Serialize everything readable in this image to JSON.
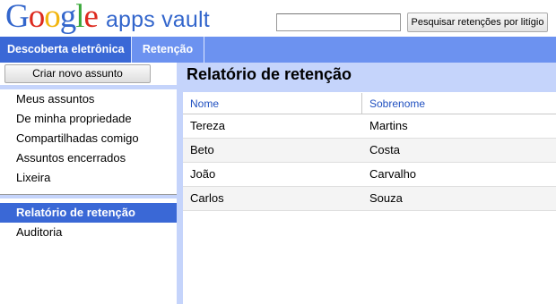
{
  "header": {
    "logo": {
      "text": "Google",
      "product": "apps vault",
      "letter_colors": [
        "#3366cc",
        "#dd2a1f",
        "#f2b50f",
        "#3366cc",
        "#3aa93a",
        "#dd2a1f"
      ]
    },
    "search": {
      "value": "",
      "button_label": "Pesquisar retenções por litígio"
    }
  },
  "nav": {
    "tabs": [
      {
        "label": "Descoberta eletrônica",
        "active": true
      },
      {
        "label": "Retenção",
        "active": false
      }
    ]
  },
  "sidebar": {
    "create_button_label": "Criar novo assunto",
    "items": [
      {
        "label": "Meus assuntos"
      },
      {
        "label": "De minha propriedade"
      },
      {
        "label": "Compartilhadas comigo"
      },
      {
        "label": "Assuntos encerrados"
      },
      {
        "label": "Lixeira"
      }
    ],
    "items2": [
      {
        "label": "Relatório de retenção",
        "selected": true
      },
      {
        "label": "Auditoria",
        "selected": false
      }
    ]
  },
  "main": {
    "title": "Relatório de retenção",
    "table": {
      "columns": [
        "Nome",
        "Sobrenome"
      ],
      "rows": [
        [
          "Tereza",
          "Martins"
        ],
        [
          "Beto",
          "Costa"
        ],
        [
          "João",
          "Carvalho"
        ],
        [
          "Carlos",
          "Souza"
        ]
      ]
    }
  },
  "colors": {
    "nav_bar": "#6c92f0",
    "nav_active": "#3a68d6",
    "panel_light": "#c5d4fb",
    "link_blue": "#2050c0"
  }
}
